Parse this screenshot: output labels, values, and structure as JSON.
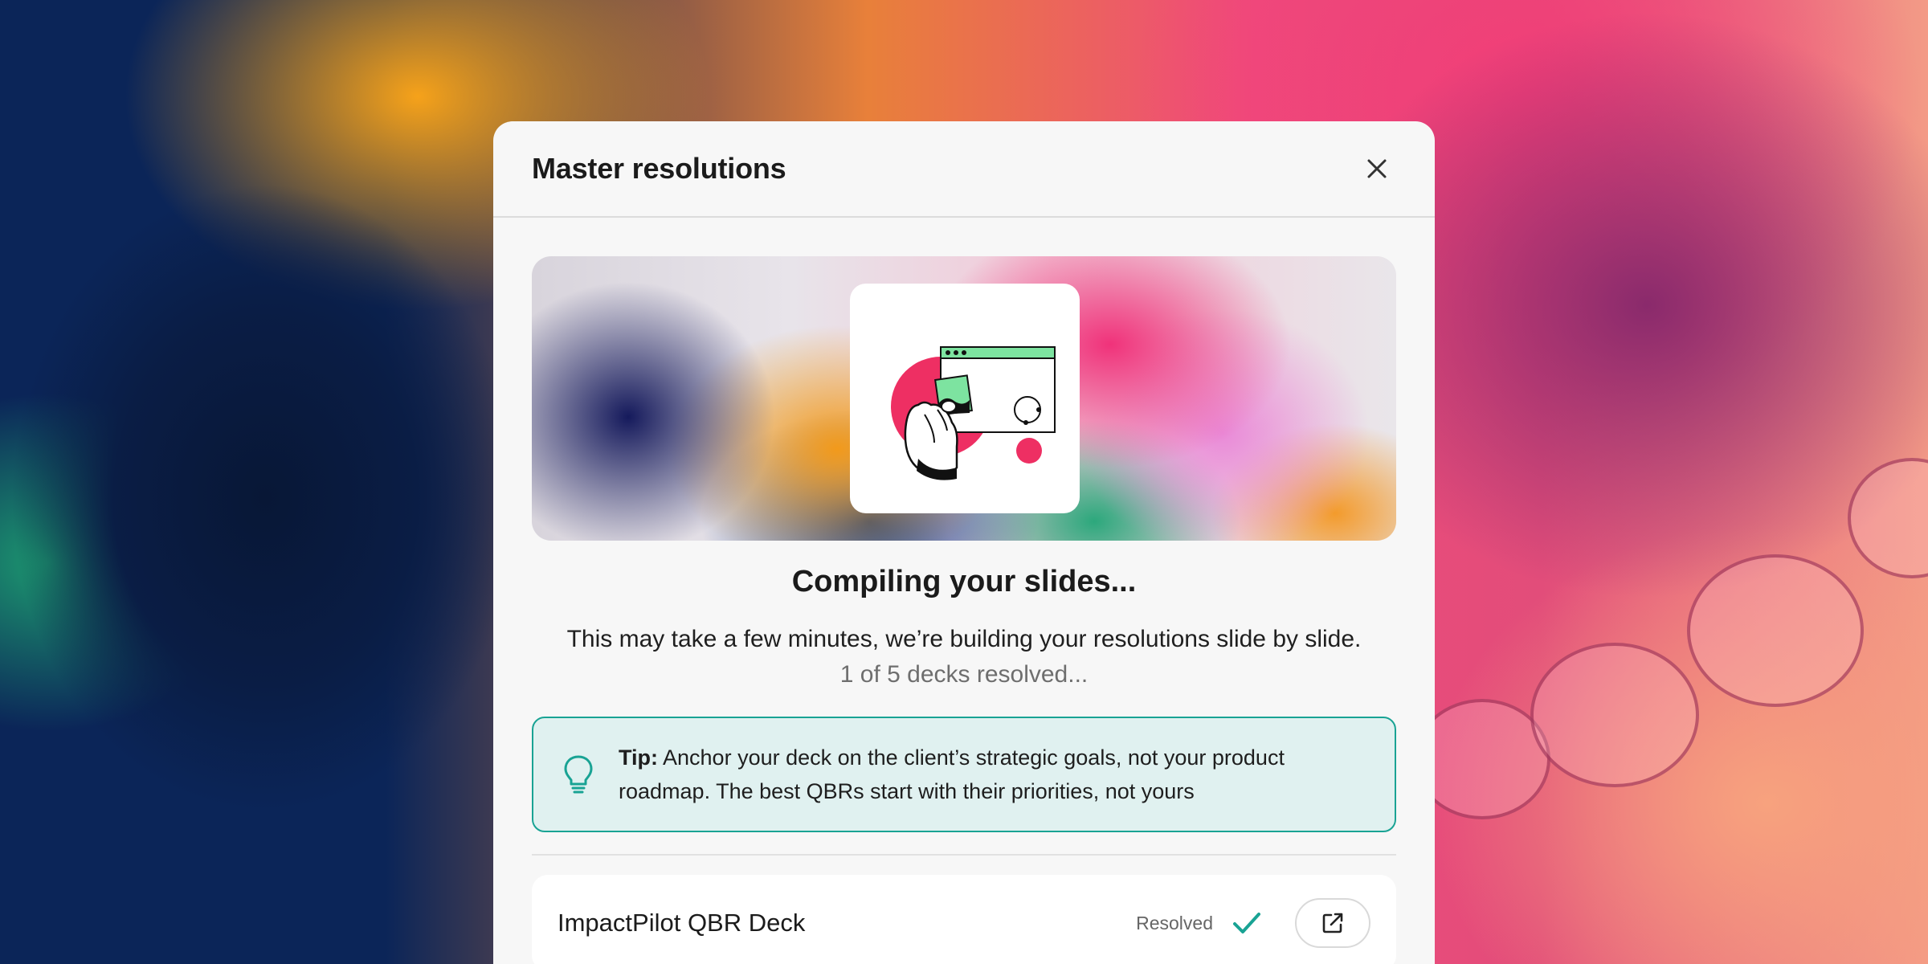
{
  "modal": {
    "title": "Master resolutions",
    "close_icon": "close-icon"
  },
  "status": {
    "title": "Compiling your slides...",
    "description": "This may take a few minutes, we’re building your resolutions slide by slide.",
    "progress_text": "1 of 5 decks resolved..."
  },
  "tip": {
    "icon": "lightbulb-icon",
    "label": "Tip:",
    "text": "Anchor your deck on the client’s strategic goals, not your product roadmap. The best QBRs start with their priorities, not yours"
  },
  "decks": [
    {
      "name": "ImpactPilot QBR Deck",
      "status": "Resolved",
      "status_icon": "check-icon",
      "action_icon": "external-link-icon"
    }
  ],
  "colors": {
    "accent_teal": "#19a394",
    "tip_background": "#e0f1f0",
    "modal_background": "#f7f7f7"
  }
}
